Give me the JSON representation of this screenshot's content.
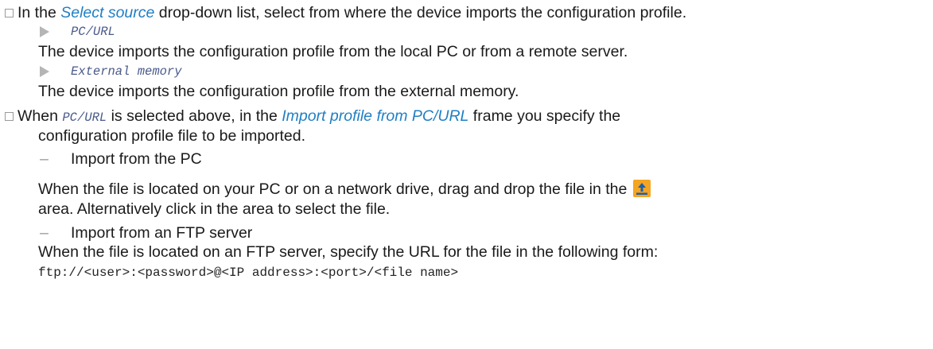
{
  "step1": {
    "pre": "In the ",
    "ui": "Select source",
    "post": " drop-down list, select from where the device imports the configuration profile.",
    "options": [
      {
        "name": "PC/URL",
        "desc": "The device imports the configuration profile from the local PC or from a remote server."
      },
      {
        "name": "External memory",
        "desc": "The device imports the configuration profile from the external memory."
      }
    ]
  },
  "step2": {
    "pre": "When ",
    "code": "PC/URL",
    "mid": " is selected above, in the ",
    "ui": "Import profile from PC/URL",
    "post": " frame you specify the",
    "line2": "configuration profile file to be imported.",
    "items": [
      {
        "title": "Import from the PC",
        "text1_pre": "When the file is located on your PC or on a network drive, drag and drop the file in the ",
        "text2": "area. Alternatively click in the area to select the file."
      },
      {
        "title": "Import from an FTP server",
        "text1": "When the file is located on an FTP server, specify the URL for the file in the following form:",
        "code": "ftp://<user>:<password>@<IP address>:<port>/<file name>"
      }
    ]
  },
  "icons": {
    "checkbox": "checkbox-icon",
    "bullet": "triangle-bullet-icon",
    "upload": "upload-icon"
  },
  "colors": {
    "ui_text": "#1f7fc4",
    "upload_icon_bg": "#f4a523"
  }
}
